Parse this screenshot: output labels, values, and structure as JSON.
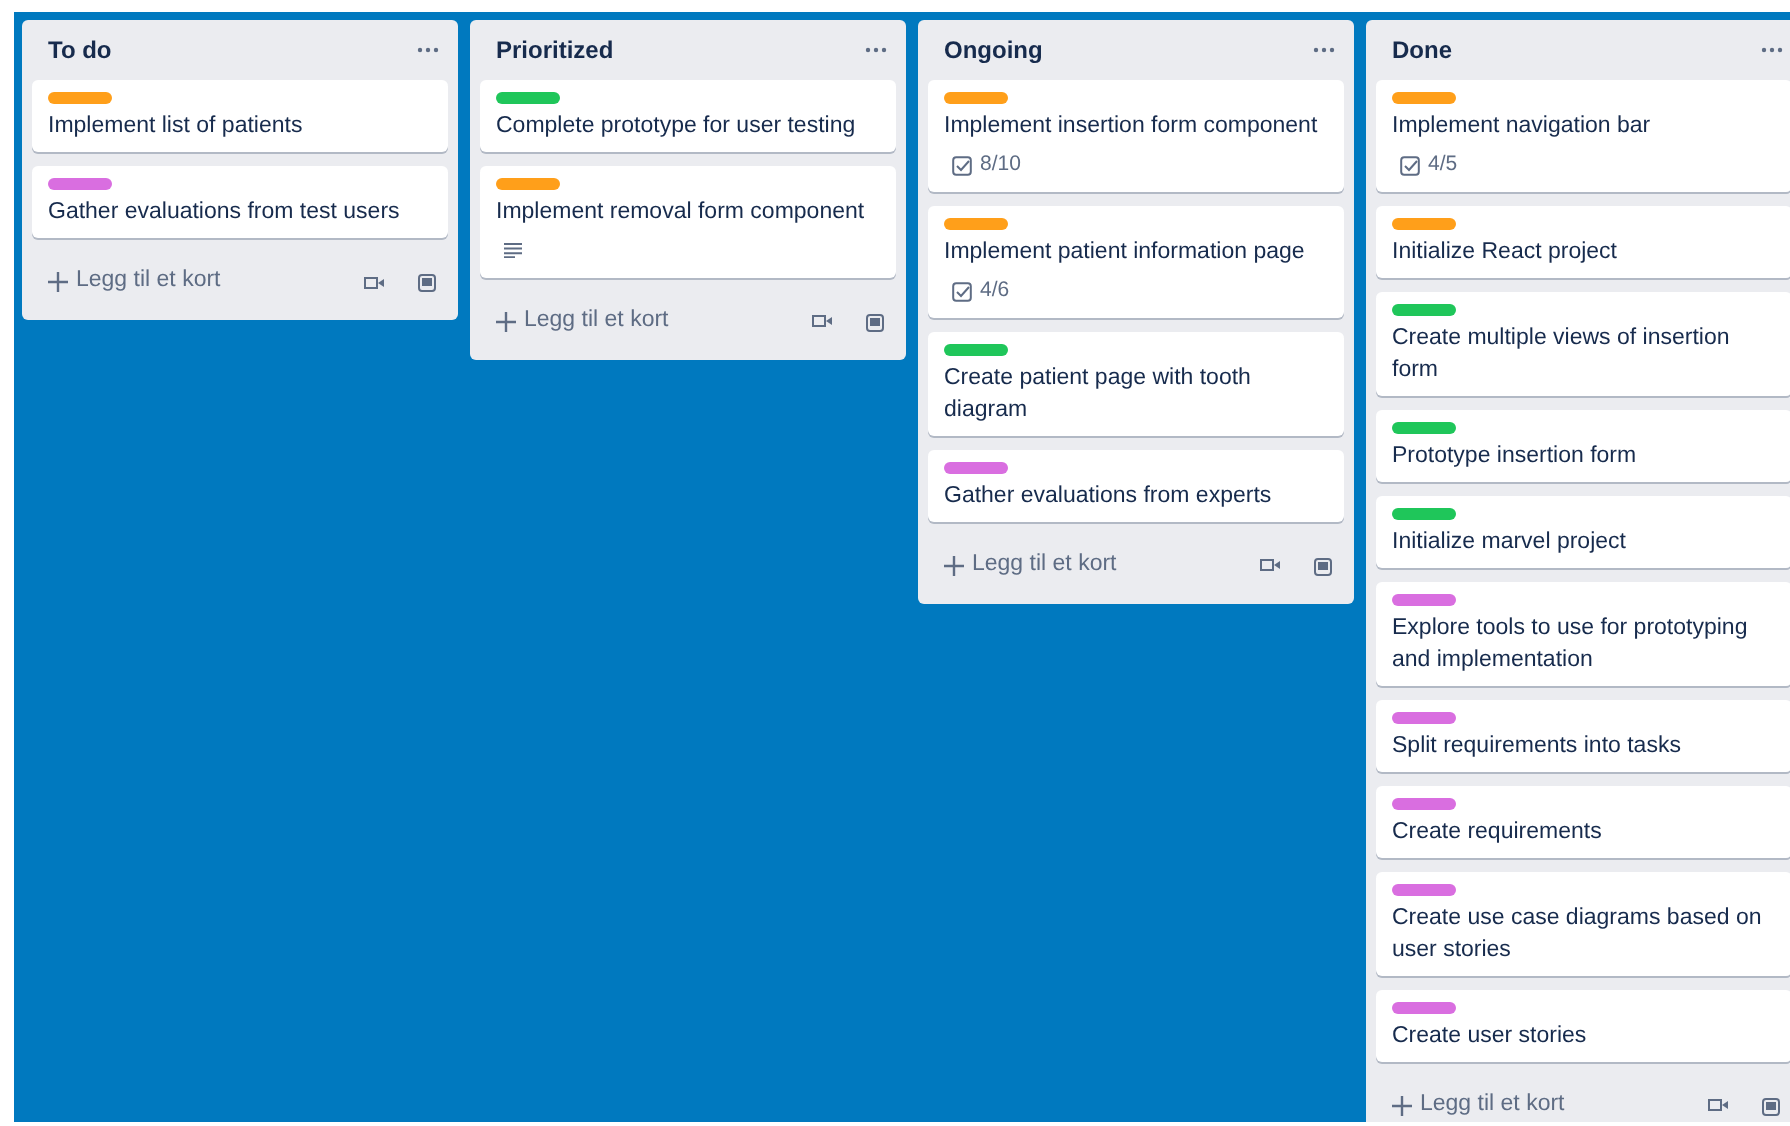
{
  "lists": [
    {
      "title": "To do",
      "add_card": "Legg til et kort",
      "cards": [
        {
          "title": "Implement list of patients",
          "color": "#ff9f1a"
        },
        {
          "title": "Gather evaluations from test users",
          "color": "#d96ee0"
        }
      ]
    },
    {
      "title": "Prioritized",
      "add_card": "Legg til et kort",
      "cards": [
        {
          "title": "Complete prototype for user testing",
          "color": "#1fc65a"
        },
        {
          "title": "Implement removal form component",
          "color": "#ff9f1a",
          "description": true
        }
      ]
    },
    {
      "title": "Ongoing",
      "add_card": "Legg til et kort",
      "cards": [
        {
          "title": "Implement insertion form component",
          "color": "#ff9f1a",
          "checklist": "8/10"
        },
        {
          "title": "Implement patient information page",
          "color": "#ff9f1a",
          "checklist": "4/6"
        },
        {
          "title": "Create patient page with tooth diagram",
          "color": "#1fc65a"
        },
        {
          "title": "Gather evaluations from experts",
          "color": "#d96ee0"
        }
      ]
    },
    {
      "title": "Done",
      "add_card": "Legg til et kort",
      "cards": [
        {
          "title": "Implement navigation bar",
          "color": "#ff9f1a",
          "checklist": "4/5"
        },
        {
          "title": "Initialize React project",
          "color": "#ff9f1a"
        },
        {
          "title": "Create multiple views of insertion form",
          "color": "#1fc65a"
        },
        {
          "title": "Prototype insertion form",
          "color": "#1fc65a"
        },
        {
          "title": "Initialize marvel project",
          "color": "#1fc65a"
        },
        {
          "title": "Explore tools to use for prototyping and implementation",
          "color": "#d96ee0"
        },
        {
          "title": "Split requirements into tasks",
          "color": "#d96ee0"
        },
        {
          "title": "Create requirements",
          "color": "#d96ee0"
        },
        {
          "title": "Create use case diagrams based on user stories",
          "color": "#d96ee0"
        },
        {
          "title": "Create user stories",
          "color": "#d96ee0"
        }
      ]
    }
  ]
}
